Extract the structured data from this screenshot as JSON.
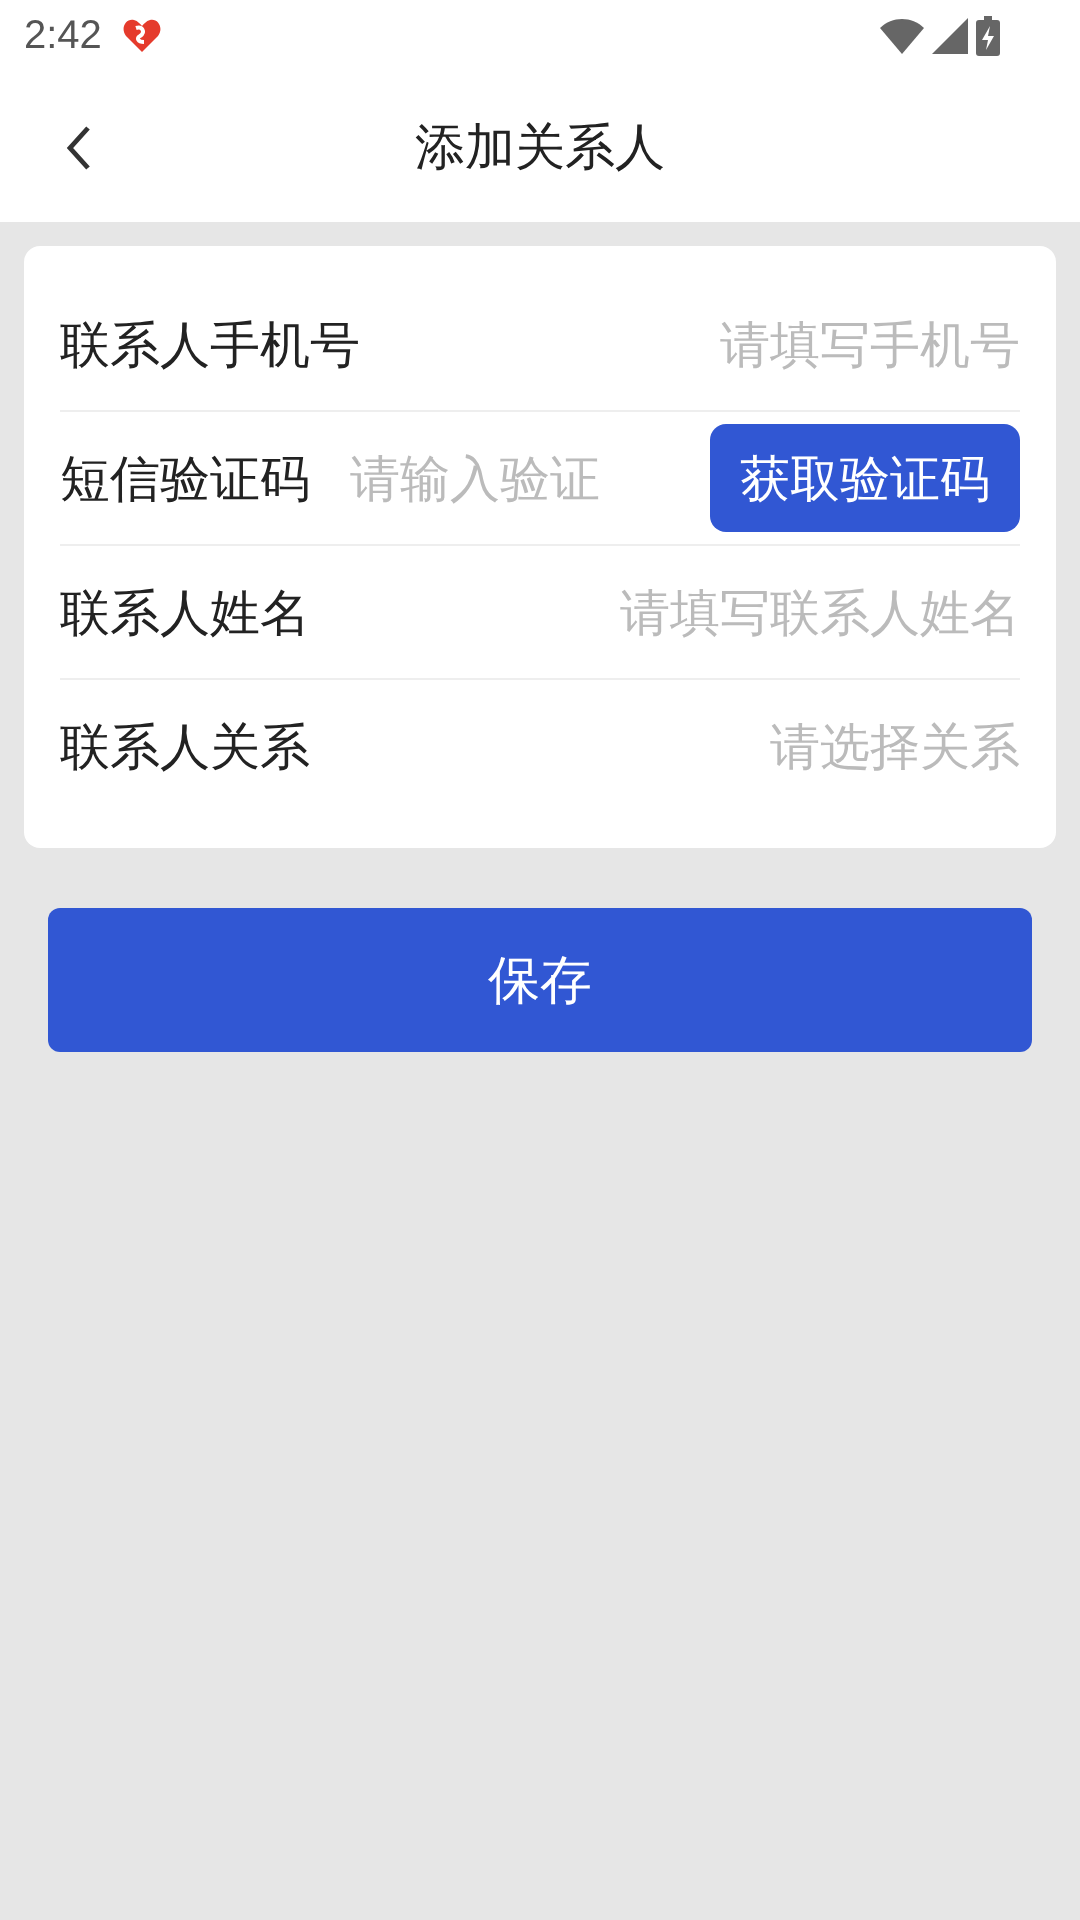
{
  "status_bar": {
    "time": "2:42"
  },
  "header": {
    "title": "添加关系人"
  },
  "form": {
    "fields": [
      {
        "kind": "input",
        "label": "联系人手机号",
        "placeholder": "请填写手机号"
      },
      {
        "kind": "code",
        "label": "短信验证码",
        "placeholder": "请输入验证",
        "button": "获取验证码"
      },
      {
        "kind": "input",
        "label": "联系人姓名",
        "placeholder": "请填写联系人姓名"
      },
      {
        "kind": "select",
        "label": "联系人关系",
        "placeholder": "请选择关系"
      }
    ]
  },
  "save_button": {
    "label": "保存"
  }
}
